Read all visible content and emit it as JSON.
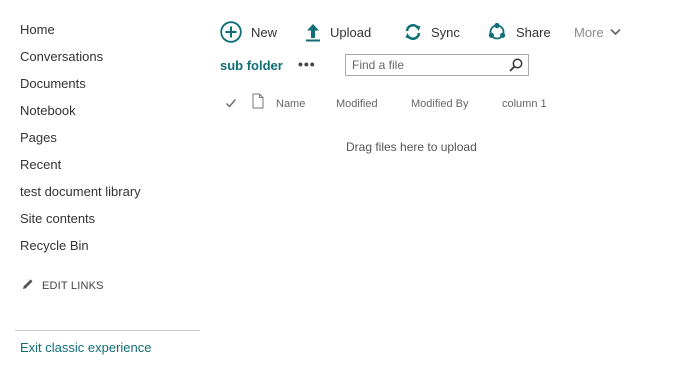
{
  "nav": {
    "items": [
      {
        "label": "Home"
      },
      {
        "label": "Conversations"
      },
      {
        "label": "Documents"
      },
      {
        "label": "Notebook"
      },
      {
        "label": "Pages"
      },
      {
        "label": "Recent"
      },
      {
        "label": "test document library"
      },
      {
        "label": "Site contents"
      },
      {
        "label": "Recycle Bin"
      }
    ],
    "edit_links": "EDIT LINKS",
    "exit_link": "Exit classic experience"
  },
  "commands": {
    "new": "New",
    "upload": "Upload",
    "sync": "Sync",
    "share": "Share",
    "more": "More"
  },
  "breadcrumb": {
    "current": "sub folder",
    "ellipsis": "•••"
  },
  "search": {
    "placeholder": "Find a file"
  },
  "list": {
    "columns": {
      "name": "Name",
      "modified": "Modified",
      "modified_by": "Modified By",
      "column1": "column 1"
    },
    "empty_message": "Drag files here to upload"
  },
  "colors": {
    "accent": "#0f6e76",
    "text": "#333333",
    "muted": "#8a8a8a"
  }
}
